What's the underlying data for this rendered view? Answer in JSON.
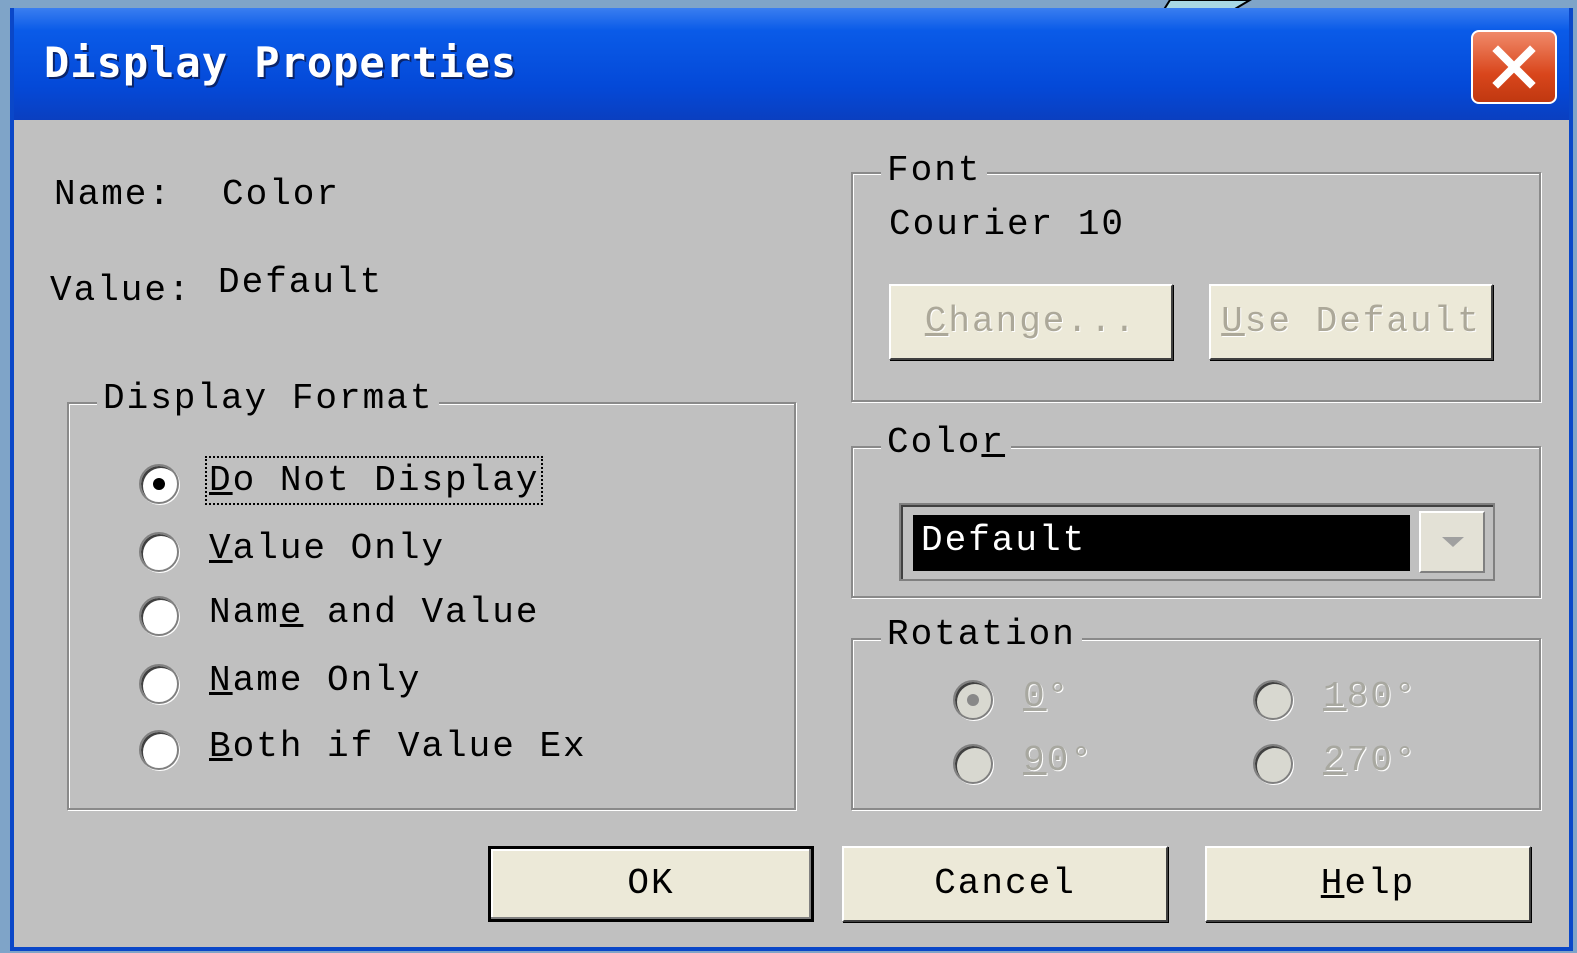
{
  "window": {
    "title": "Display Properties",
    "close_label": "X"
  },
  "info": {
    "name_label": "Name:",
    "name_value": "Color",
    "value_label": "Value:",
    "value_value": "Default"
  },
  "display_format": {
    "legend": "Display Format",
    "options": [
      {
        "pre": "",
        "ul": "D",
        "post": "o Not Display",
        "checked": true
      },
      {
        "pre": "",
        "ul": "V",
        "post": "alue Only",
        "checked": false
      },
      {
        "pre": "Nam",
        "ul": "e",
        "post": " and Value",
        "checked": false
      },
      {
        "pre": "",
        "ul": "N",
        "post": "ame Only",
        "checked": false
      },
      {
        "pre": "",
        "ul": "B",
        "post": "oth if Value Ex",
        "checked": false
      }
    ]
  },
  "font": {
    "legend": "Font",
    "current": "Courier 10",
    "change_ul": "C",
    "change_rest": "hange...",
    "use_default_ul": "U",
    "use_default_rest": "se Default"
  },
  "color": {
    "legend_pre": "Colo",
    "legend_ul": "r",
    "selected": "Default"
  },
  "rotation": {
    "legend": "Rotation",
    "options": [
      {
        "ul": "0",
        "post": "°",
        "checked": true
      },
      {
        "ul": "1",
        "post": "80°",
        "checked": false
      },
      {
        "ul": "9",
        "post": "0°",
        "checked": false
      },
      {
        "ul": "2",
        "post": "70°",
        "checked": false
      }
    ]
  },
  "buttons": {
    "ok": "OK",
    "cancel": "Cancel",
    "help_ul": "H",
    "help_rest": "elp"
  }
}
